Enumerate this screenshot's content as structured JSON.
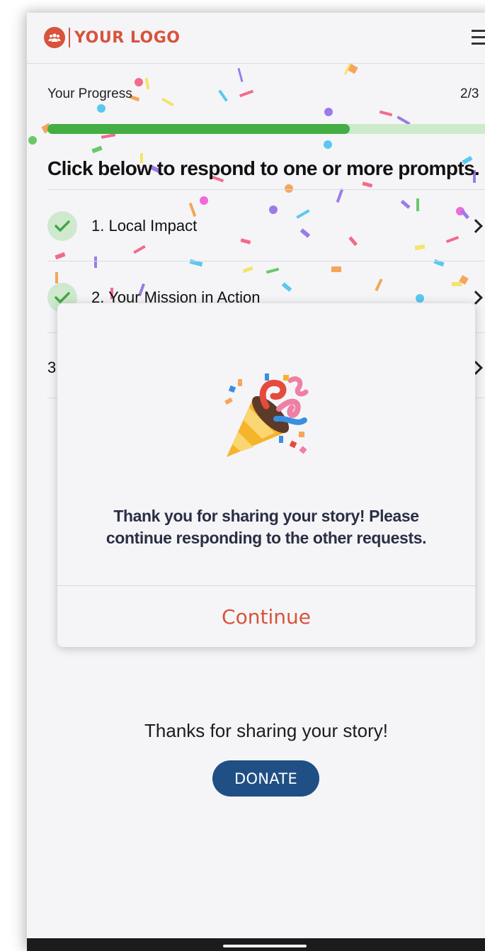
{
  "header": {
    "logo_text": "YOUR LOGO",
    "logo_icon": "group-people-icon",
    "menu_icon": "hamburger-menu-icon",
    "brand_color": "#d9533b"
  },
  "progress": {
    "label": "Your Progress",
    "count_text": "2/3",
    "completed": 2,
    "total": 3,
    "fill_color": "#44ae44",
    "track_color": "#cdeacb"
  },
  "instructions": "Click below to respond to one or more prompts.",
  "prompts": [
    {
      "label": "1. Local Impact",
      "completed": true
    },
    {
      "label": "2. Your Mission in Action",
      "completed": true
    },
    {
      "label": "3",
      "completed": false
    }
  ],
  "modal": {
    "icon": "party-popper-icon",
    "message": "Thank you for sharing your story! Please continue responding to the other requests.",
    "continue_label": "Continue"
  },
  "footer": {
    "thanks_text": "Thanks for sharing your story!",
    "donate_label": "DONATE",
    "donate_color": "#1f4f85"
  }
}
